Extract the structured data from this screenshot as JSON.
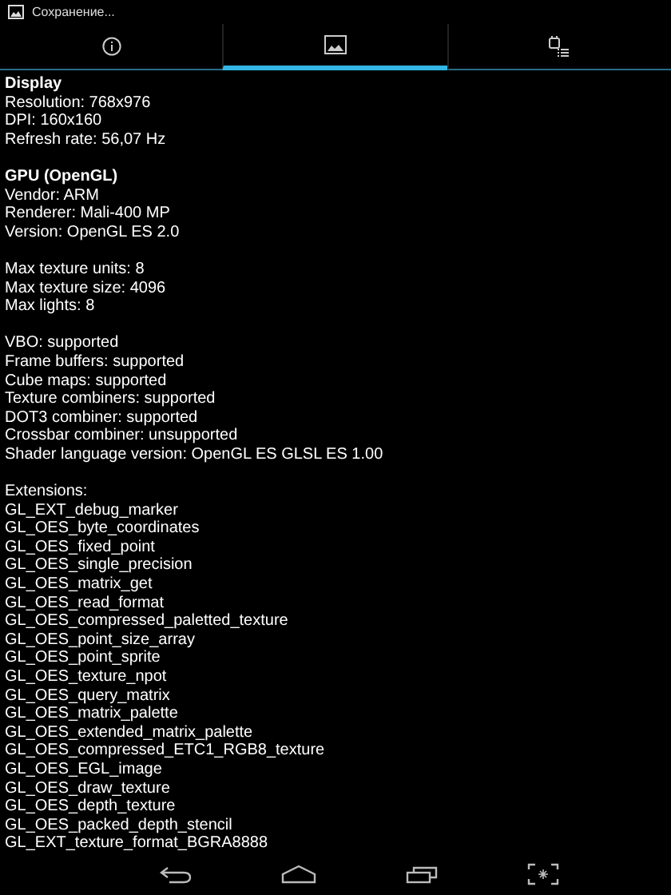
{
  "status_bar": {
    "notification": "Сохранение..."
  },
  "tabs": [
    {
      "kind": "info",
      "selected": false
    },
    {
      "kind": "image",
      "selected": true
    },
    {
      "kind": "device",
      "selected": false
    }
  ],
  "sections": [
    {
      "title": "Display",
      "lines": [
        "Resolution: 768x976",
        "DPI: 160x160",
        "Refresh rate: 56,07 Hz"
      ]
    },
    {
      "title": "GPU (OpenGL)",
      "lines": [
        "Vendor: ARM",
        "Renderer: Mali-400 MP",
        "Version: OpenGL ES 2.0"
      ]
    },
    {
      "lines": [
        "Max texture units: 8",
        "Max texture size: 4096",
        "Max lights: 8"
      ]
    },
    {
      "lines": [
        "VBO: supported",
        "Frame buffers: supported",
        "Cube maps: supported",
        "Texture combiners: supported",
        "DOT3 combiner: supported",
        "Crossbar combiner: unsupported",
        "Shader language version: OpenGL ES GLSL ES 1.00"
      ]
    },
    {
      "lines": [
        "Extensions:",
        "GL_EXT_debug_marker",
        "GL_OES_byte_coordinates",
        "GL_OES_fixed_point",
        "GL_OES_single_precision",
        "GL_OES_matrix_get",
        "GL_OES_read_format",
        "GL_OES_compressed_paletted_texture",
        "GL_OES_point_size_array",
        "GL_OES_point_sprite",
        "GL_OES_texture_npot",
        "GL_OES_query_matrix",
        "GL_OES_matrix_palette",
        "GL_OES_extended_matrix_palette",
        "GL_OES_compressed_ETC1_RGB8_texture",
        "GL_OES_EGL_image",
        "GL_OES_draw_texture",
        "GL_OES_depth_texture",
        "GL_OES_packed_depth_stencil",
        "GL_EXT_texture_format_BGRA8888"
      ]
    }
  ]
}
